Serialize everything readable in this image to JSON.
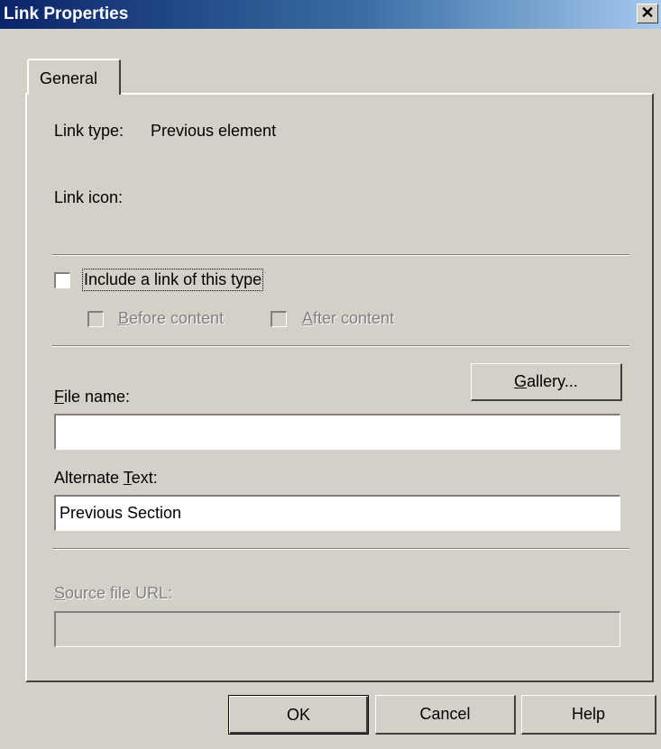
{
  "window": {
    "title": "Link Properties",
    "close_glyph": "✕",
    "close_icon": "close-icon"
  },
  "tabs": [
    {
      "label": "General",
      "selected": true
    }
  ],
  "general": {
    "link_type_label": "Link type:",
    "link_type_value": "Previous element",
    "link_icon_label": "Link icon:",
    "include_link": {
      "label": "Include a link of this type",
      "checked": false
    },
    "before_content": {
      "accel": "B",
      "rest": "efore content",
      "checked": false,
      "enabled": false
    },
    "after_content": {
      "accel": "A",
      "rest": "fter content",
      "checked": false,
      "enabled": false
    },
    "gallery_button": {
      "accel": "G",
      "rest": "allery..."
    },
    "file_name": {
      "accel": "F",
      "rest": "ile name:",
      "value": ""
    },
    "alternate_text": {
      "prefix": "Alternate ",
      "accel": "T",
      "rest": "ext:",
      "value": "Previous Section"
    },
    "source_file_url": {
      "accel": "S",
      "rest": "ource file URL:",
      "value": "",
      "enabled": false
    }
  },
  "footer": {
    "ok_label": "OK",
    "cancel_label": "Cancel",
    "help_label": "Help"
  }
}
